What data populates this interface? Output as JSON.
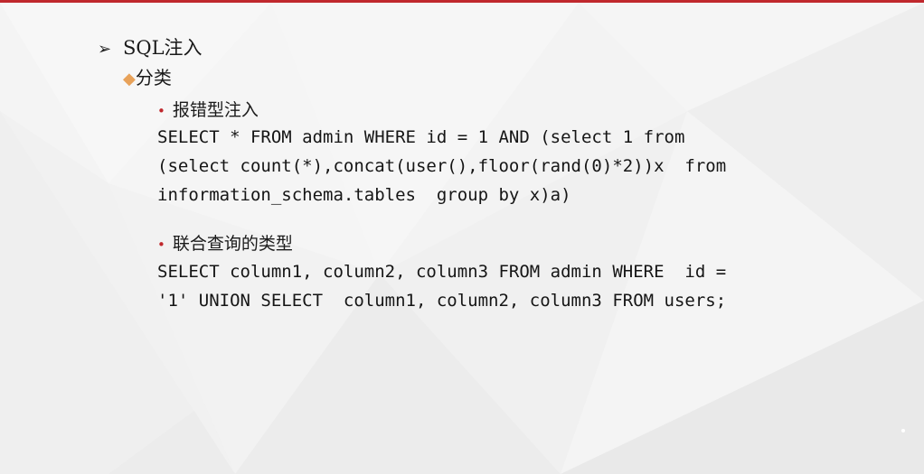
{
  "theme": {
    "accent": "#c0282d",
    "diamond": "#e8a25a",
    "background": "#f4f4f4"
  },
  "outline": {
    "title": "SQL注入",
    "title_icon": "arrow-bullet-icon",
    "subtitle": "分类",
    "subtitle_icon": "diamond-bullet-icon",
    "items": [
      {
        "heading": "报错型注入",
        "code_lines": [
          "SELECT * FROM admin WHERE id = 1 AND (select 1 from",
          "(select count(*),concat(user(),floor(rand(0)*2))x  from",
          "information_schema.tables  group by x)a)"
        ]
      },
      {
        "heading": "联合查询的类型",
        "code_lines": [
          "SELECT column1, column2, column3 FROM admin WHERE  id =",
          "'1' UNION SELECT  column1, column2, column3 FROM users;"
        ]
      }
    ]
  }
}
